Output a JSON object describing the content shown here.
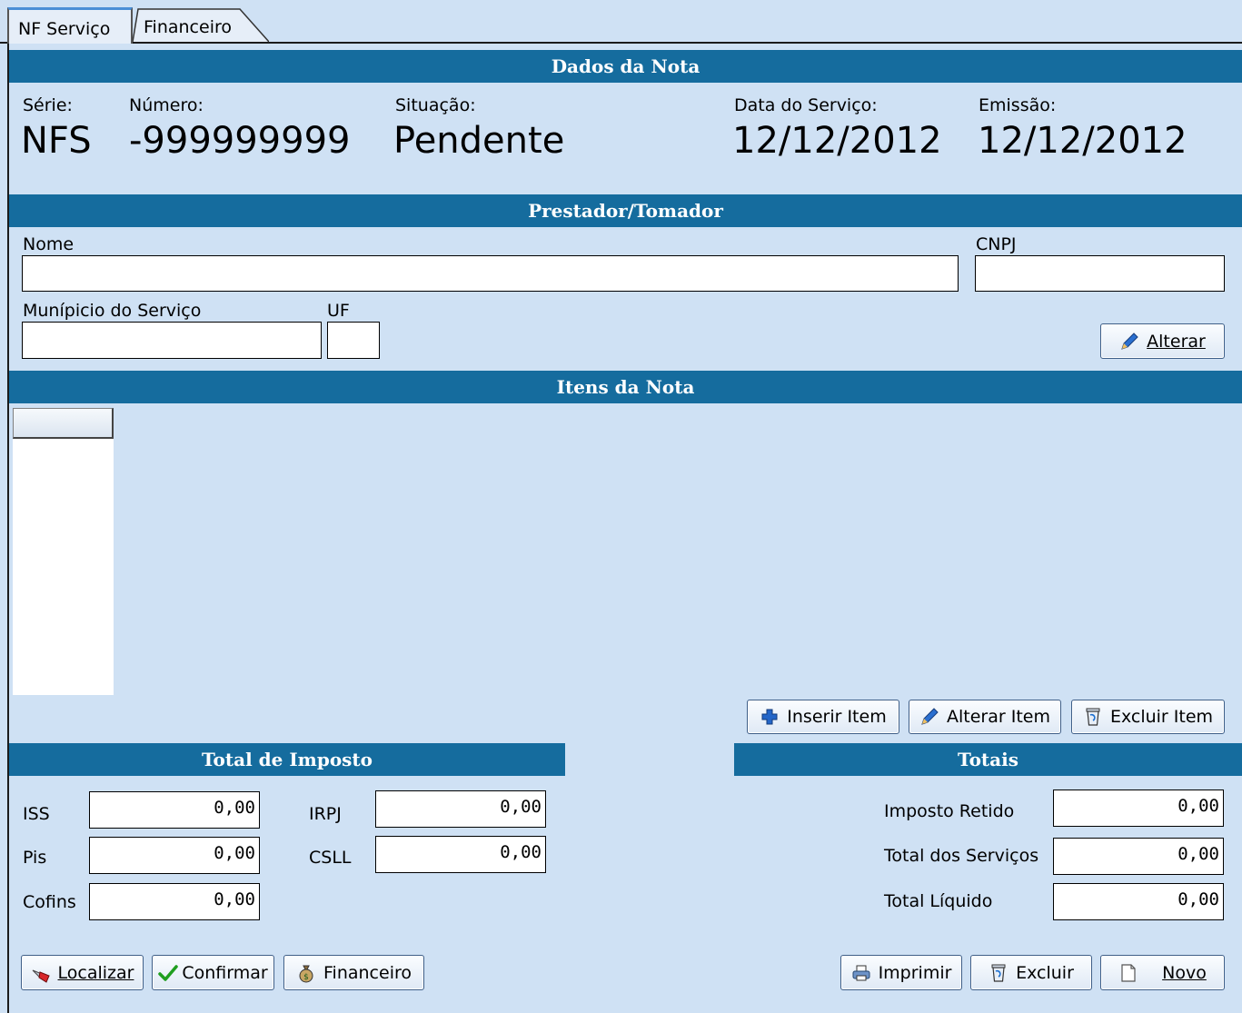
{
  "tabs": [
    {
      "label": "NF Serviço",
      "active": true
    },
    {
      "label": "Financeiro",
      "active": false
    }
  ],
  "dados_nota": {
    "header": "Dados da Nota",
    "serie_label": "Série:",
    "serie_value": "NFS",
    "numero_label": "Número:",
    "numero_value": "-999999999",
    "situacao_label": "Situação:",
    "situacao_value": "Pendente",
    "data_servico_label": "Data do Serviço:",
    "data_servico_value": "12/12/2012",
    "emissao_label": "Emissão:",
    "emissao_value": "12/12/2012"
  },
  "prestador": {
    "header": "Prestador/Tomador",
    "nome_label": "Nome",
    "nome_value": "",
    "cnpj_label": "CNPJ",
    "cnpj_value": "",
    "municipio_label": "Munípicio do Serviço",
    "municipio_value": "",
    "uf_label": "UF",
    "uf_value": "",
    "alterar_button": "Alterar"
  },
  "itens": {
    "header": "Itens da Nota",
    "inserir_button": "Inserir Item",
    "alterar_button": "Alterar Item",
    "excluir_button": "Excluir Item"
  },
  "impostos": {
    "header": "Total de Imposto",
    "iss_label": "ISS",
    "iss_value": "0,00",
    "pis_label": "Pis",
    "pis_value": "0,00",
    "cofins_label": "Cofins",
    "cofins_value": "0,00",
    "irpj_label": "IRPJ",
    "irpj_value": "0,00",
    "csll_label": "CSLL",
    "csll_value": "0,00"
  },
  "totais": {
    "header": "Totais",
    "imposto_retido_label": "Imposto Retido",
    "imposto_retido_value": "0,00",
    "total_servicos_label": "Total dos Serviços",
    "total_servicos_value": "0,00",
    "total_liquido_label": "Total Líquido",
    "total_liquido_value": "0,00"
  },
  "footer": {
    "localizar": "Localizar",
    "confirmar": "Confirmar",
    "financeiro": "Financeiro",
    "imprimir": "Imprimir",
    "excluir": "Excluir",
    "novo": "Novo"
  },
  "colors": {
    "background": "#cfe1f4",
    "section_header": "#156c9e",
    "section_text": "#ffffff"
  }
}
